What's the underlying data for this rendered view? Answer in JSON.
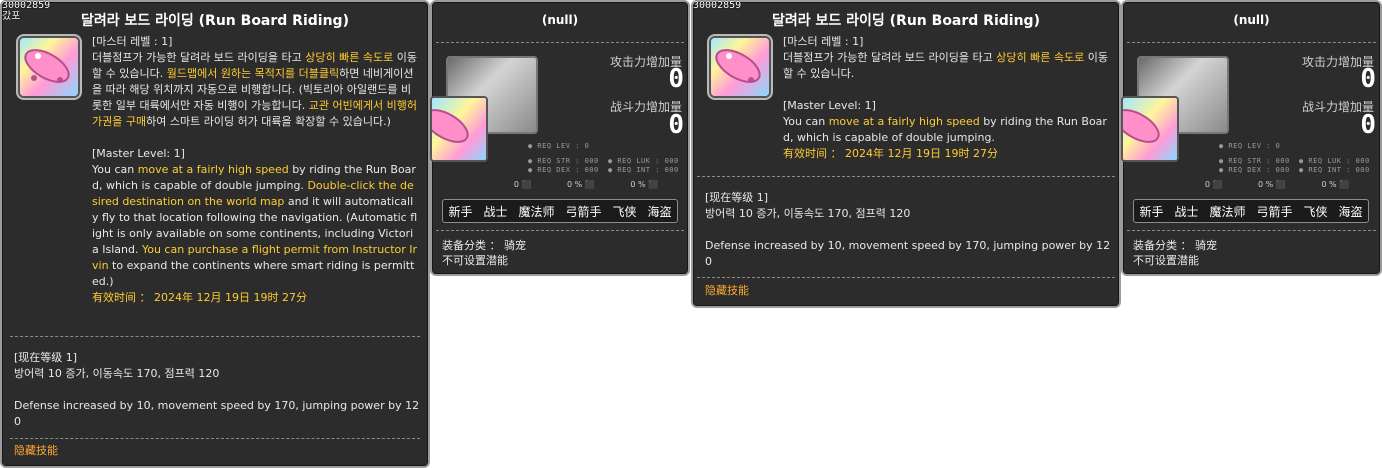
{
  "item_id": "30002859",
  "left_sticker": "갔포",
  "skill": {
    "title": "달려라 보드 라이딩 (Run Board Riding)",
    "kr_level": "[마스터 레벨 : 1]",
    "kr_desc": [
      {
        "t": "더블점프가 가능한 달려라 보드 라이딩을 타고 ",
        "h": false
      },
      {
        "t": "상당히 빠른 속도로",
        "h": true
      },
      {
        "t": " 이동할 수 있습니다. ",
        "h": false
      },
      {
        "t": "월드맵에서 원하는 목적지를 더블클릭",
        "h": true
      },
      {
        "t": "하면 네비게이션을 따라 해당 위치까지 자동으로 비행합니다. (빅토리아 아일랜드를 비롯한 일부 대륙에서만 자동 비행이 가능합니다. ",
        "h": false
      },
      {
        "t": "교관 어빈에게서 비행허가권을 구매",
        "h": true
      },
      {
        "t": "하여 스마트 라이딩 허가 대륙을 확장할 수 있습니다.)",
        "h": false
      }
    ],
    "kr_desc_short": [
      {
        "t": "더블점프가 가능한 달려라 보드 라이딩을 타고 ",
        "h": false
      },
      {
        "t": "상당히 빠른 속도로",
        "h": true
      },
      {
        "t": " 이동할 수 있습니다.",
        "h": false
      }
    ],
    "en_level": "[Master Level: 1]",
    "en_desc": [
      {
        "t": "You can ",
        "h": false
      },
      {
        "t": "move at a fairly high speed",
        "h": true
      },
      {
        "t": " by riding the Run Board, which is capable of double jumping. ",
        "h": false
      },
      {
        "t": "Double-click the desired destination on the world map",
        "h": true
      },
      {
        "t": " and it will automatically fly to that location following the navigation. (Automatic flight is only available on some continents, including Victoria Island. ",
        "h": false
      },
      {
        "t": "You can purchase a flight permit from Instructor Irvin",
        "h": true
      },
      {
        "t": " to expand the continents where smart riding is permitted.)",
        "h": false
      }
    ],
    "en_desc_short": [
      {
        "t": "You can ",
        "h": false
      },
      {
        "t": "move at a fairly high speed",
        "h": true
      },
      {
        "t": " by riding the Run Board, which is capable of double jumping.",
        "h": false
      }
    ],
    "expiry": "有效时间 ： 2024年 12月 19日 19时 27分",
    "current_level": "[现在等级 1]",
    "current_effect_kr": "방어력 10 증가, 이동속도 170, 점프력 120",
    "current_effect_en": "Defense increased by 10, movement speed by 170, jumping power by 120",
    "hidden_skill": "隐藏技能"
  },
  "equip": {
    "title": "(null)",
    "atk_label": "攻击力增加量",
    "atk_value": "0",
    "combat_label": "战斗力增加量",
    "combat_value": "0",
    "req_lev": "● REQ LEV :    0",
    "req_str": "● REQ STR : 000",
    "req_luk": "● REQ LUK : 000",
    "req_dex": "● REQ DEX : 000",
    "req_int": "● REQ INT : 000",
    "small_icon_labels": [
      "0",
      "0 %",
      "0 %"
    ],
    "jobs": [
      "新手",
      "战士",
      "魔法师",
      "弓箭手",
      "飞侠",
      "海盗"
    ],
    "category": "装备分类 ： 骑宠",
    "potential": "不可设置潜能"
  },
  "colors": {
    "panel_bg": "#2c2c2c",
    "highlight": "#ffcc33",
    "hidden_skill": "#ffaa33"
  }
}
